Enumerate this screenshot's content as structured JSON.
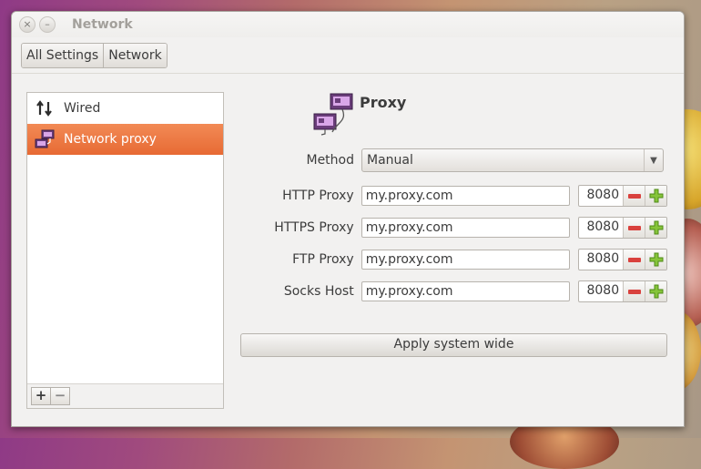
{
  "window": {
    "title": "Network"
  },
  "toolbar": {
    "crumbs": [
      "All Settings",
      "Network"
    ]
  },
  "sidebar": {
    "items": [
      {
        "label": "Wired",
        "icon": "arrows-up-down-icon",
        "selected": false
      },
      {
        "label": "Network proxy",
        "icon": "network-proxy-icon",
        "selected": true
      }
    ],
    "add_label": "+",
    "remove_label": "−"
  },
  "panel": {
    "title": "Proxy",
    "method": {
      "label": "Method",
      "value": "Manual"
    },
    "proxies": [
      {
        "label": "HTTP Proxy",
        "host": "my.proxy.com",
        "port": "8080"
      },
      {
        "label": "HTTPS Proxy",
        "host": "my.proxy.com",
        "port": "8080"
      },
      {
        "label": "FTP Proxy",
        "host": "my.proxy.com",
        "port": "8080"
      },
      {
        "label": "Socks Host",
        "host": "my.proxy.com",
        "port": "8080"
      }
    ],
    "apply_label": "Apply system wide"
  },
  "colors": {
    "accent": "#e96c37",
    "minus": "#d9413d",
    "plus": "#7bbd2e"
  }
}
